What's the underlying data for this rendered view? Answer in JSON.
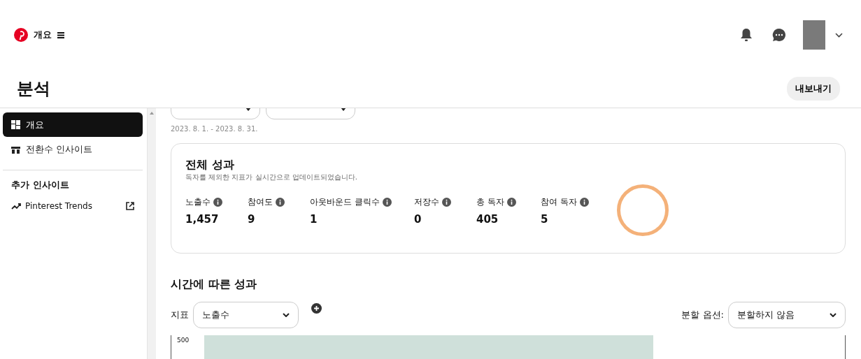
{
  "header": {
    "title": "개요"
  },
  "page": {
    "title": "분석",
    "export_button": "내보내기"
  },
  "sidebar": {
    "items": [
      {
        "label": "개요",
        "selected": true,
        "kind": "overview"
      },
      {
        "label": "전환수 인사이트",
        "selected": false,
        "kind": "conversion"
      }
    ],
    "section_title": "추가 인사이트",
    "links": [
      {
        "label": "Pinterest Trends"
      }
    ]
  },
  "filters": {
    "dropdowns": [
      {
        "kind": "dropdown"
      },
      {
        "kind": "dropdown"
      }
    ],
    "date_range": "2023. 8. 1. - 2023. 8. 31."
  },
  "overall": {
    "title": "전체 성과",
    "subtitle": "독자를 제외한 지표가 실시간으로 업데이트되었습니다.",
    "metrics": [
      {
        "label": "노출수",
        "value": "1,457"
      },
      {
        "label": "참여도",
        "value": "9"
      },
      {
        "label": "아웃바운드 클릭수",
        "value": "1"
      },
      {
        "label": "저장수",
        "value": "0"
      },
      {
        "label": "총 독자",
        "value": "405"
      },
      {
        "label": "참여 독자",
        "value": "5"
      }
    ]
  },
  "over_time": {
    "title": "시간에 따른 성과",
    "metric_label": "지표",
    "metric_value": "노출수",
    "split_label": "분할 옵션:",
    "split_value": "분할하지 않음",
    "y_tick": "500"
  }
}
